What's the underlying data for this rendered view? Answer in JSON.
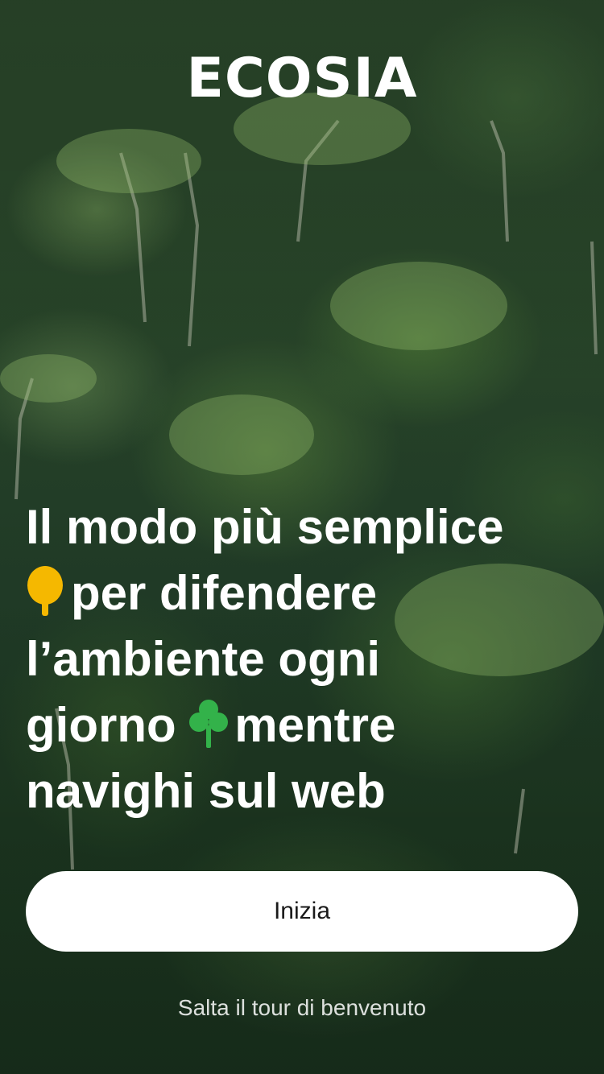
{
  "brand": {
    "logo_text": "ECOSIA"
  },
  "headline": {
    "line1": "Il modo più semplice",
    "line2": "per difendere",
    "line3": "l’ambiente ogni",
    "line4a": "giorno",
    "line4b": "mentre",
    "line5": "navighi sul web",
    "icons": [
      "tree-emoji-icon",
      "clover-emoji-icon"
    ]
  },
  "actions": {
    "start_label": "Inizia",
    "skip_label": "Salta il tour di benvenuto"
  },
  "colors": {
    "text": "#ffffff",
    "button_bg": "#ffffff",
    "button_text": "#1a1a1a",
    "tree_icon": "#f5b800",
    "clover_icon": "#33b24a"
  }
}
